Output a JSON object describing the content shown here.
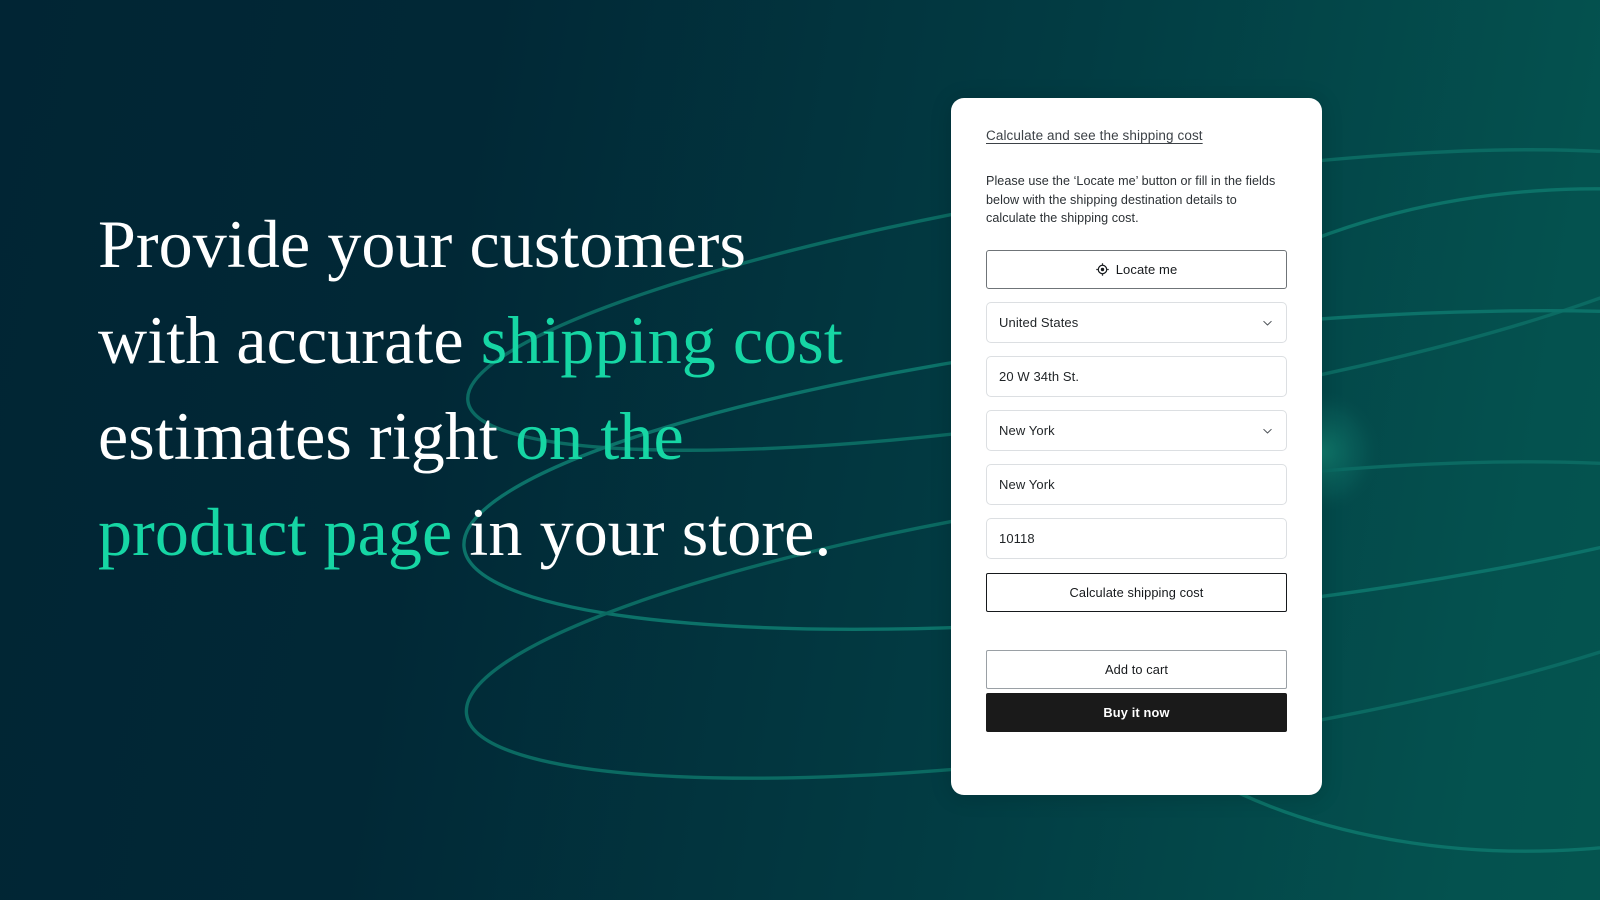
{
  "theme": {
    "background_dark": "#012534",
    "background_light": "#04524F",
    "accent_mint": "#16D6A4",
    "curve_stroke": "#0C6A63",
    "card_background": "#FFFFFF",
    "buy_button_background": "#1A1A1A"
  },
  "hero": {
    "headline_segments": [
      {
        "text": "Provide your customers with accurate ",
        "accent": false
      },
      {
        "text": "shipping cost",
        "accent": true
      },
      {
        "text": " estimates right ",
        "accent": false
      },
      {
        "text": "on the product page",
        "accent": true
      },
      {
        "text": " in your store.",
        "accent": false
      }
    ],
    "headline_plain": "Provide your customers with accurate shipping cost estimates right on the product page in your store."
  },
  "card": {
    "link_label": "Calculate and see the shipping cost",
    "description": "Please use the ‘Locate me’ button or fill in the fields below with the shipping destination details to calculate the shipping cost.",
    "locate_button": {
      "label": "Locate me",
      "icon": "crosshair-target-icon"
    },
    "fields": [
      {
        "name": "country",
        "type": "select",
        "value": "United States",
        "placeholder": "Country",
        "icon": "chevron-down-icon"
      },
      {
        "name": "address",
        "type": "text",
        "value": "20 W 34th St.",
        "placeholder": "Address"
      },
      {
        "name": "state",
        "type": "select",
        "value": "New York",
        "placeholder": "State",
        "icon": "chevron-down-icon"
      },
      {
        "name": "city",
        "type": "text",
        "value": "New York",
        "placeholder": "City"
      },
      {
        "name": "zip",
        "type": "text",
        "value": "10118",
        "placeholder": "ZIP code"
      }
    ],
    "calculate_button_label": "Calculate shipping cost",
    "add_to_cart_label": "Add to cart",
    "buy_it_now_label": "Buy it now"
  }
}
